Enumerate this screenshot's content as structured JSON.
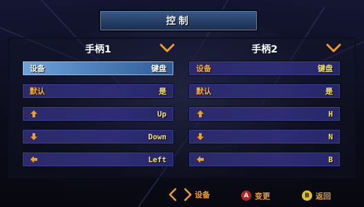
{
  "header": {
    "title": "控制"
  },
  "players": [
    {
      "name": "手柄1",
      "rows": [
        {
          "label": "设备",
          "value": "键盘",
          "icon": "none",
          "selected": true
        },
        {
          "label": "默认",
          "value": "是",
          "icon": "none",
          "selected": false
        },
        {
          "label": "",
          "value": "Up",
          "icon": "arrow-up-icon",
          "selected": false
        },
        {
          "label": "",
          "value": "Down",
          "icon": "arrow-down-icon",
          "selected": false
        },
        {
          "label": "",
          "value": "Left",
          "icon": "arrow-left-icon",
          "selected": false
        }
      ]
    },
    {
      "name": "手柄2",
      "rows": [
        {
          "label": "设备",
          "value": "键盘",
          "icon": "none",
          "selected": false
        },
        {
          "label": "默认",
          "value": "是",
          "icon": "none",
          "selected": false
        },
        {
          "label": "",
          "value": "H",
          "icon": "arrow-up-icon",
          "selected": false
        },
        {
          "label": "",
          "value": "N",
          "icon": "arrow-down-icon",
          "selected": false
        },
        {
          "label": "",
          "value": "B",
          "icon": "arrow-left-icon",
          "selected": false
        }
      ]
    }
  ],
  "footer": {
    "device_label": "设备",
    "a_button": "A",
    "a_label": "变更",
    "b_button": "B",
    "b_label": "返回"
  },
  "colors": {
    "accent_orange": "#f0a020",
    "value_yellow": "#f6e36b",
    "row_blue": "#2e2d74",
    "selected_blue": "#4f82bd"
  }
}
